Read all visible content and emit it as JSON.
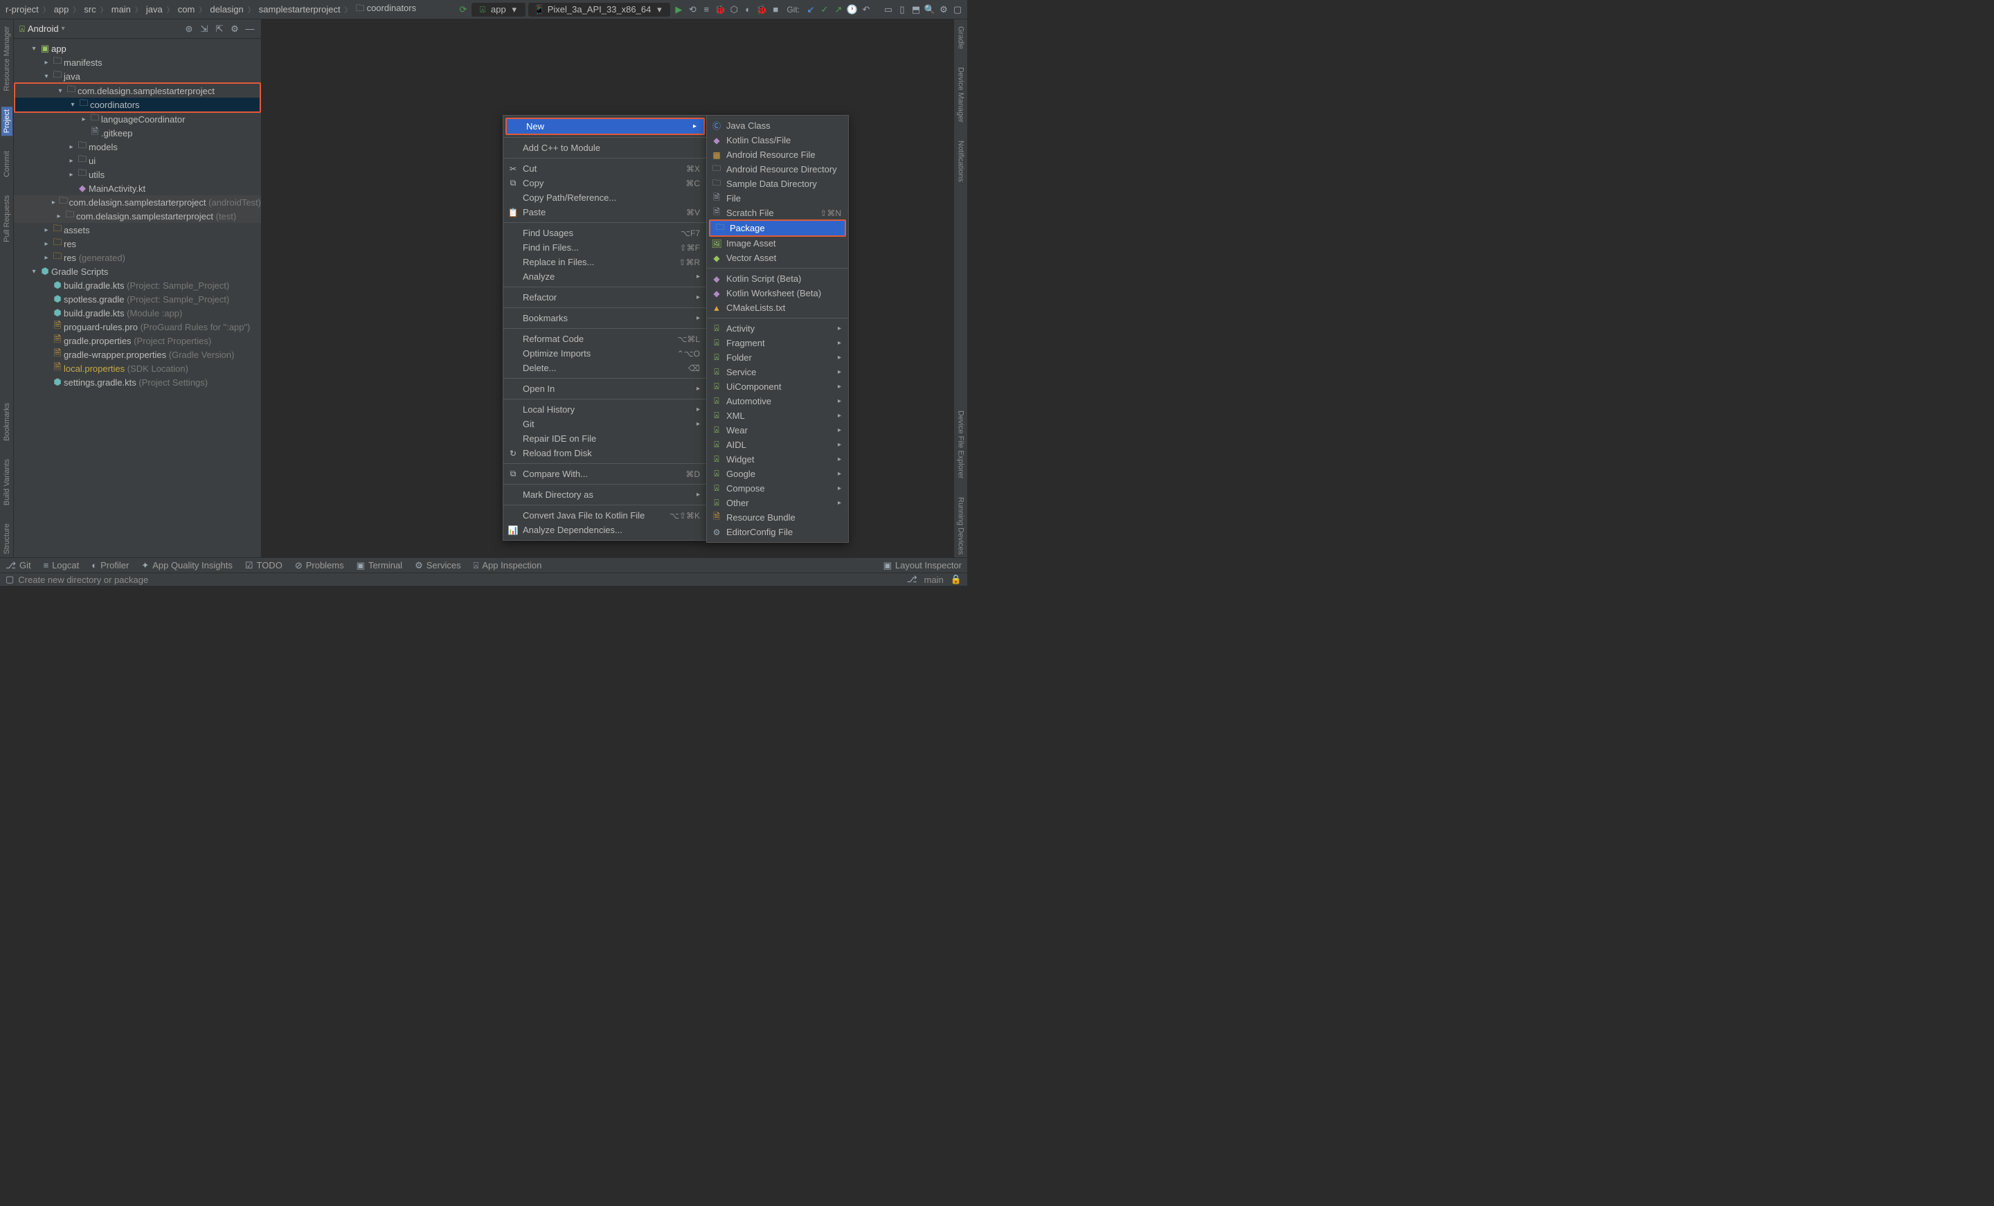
{
  "breadcrumbs": [
    "r-project",
    "app",
    "src",
    "main",
    "java",
    "com",
    "delasign",
    "samplestarterproject",
    "coordinators"
  ],
  "run_config": {
    "label": "app"
  },
  "device_select": {
    "label": "Pixel_3a_API_33_x86_64"
  },
  "git_label": "Git:",
  "left_bar": {
    "project": "Project",
    "commit": "Commit",
    "pull_requests": "Pull Requests",
    "resource_manager": "Resource Manager",
    "bookmarks": "Bookmarks",
    "build_variants": "Build Variants",
    "structure": "Structure"
  },
  "right_bar": {
    "gradle": "Gradle",
    "device_manager": "Device Manager",
    "notifications": "Notifications",
    "device_file_explorer": "Device File Explorer",
    "running_devices": "Running Devices"
  },
  "project_panel": {
    "title": "Android",
    "tree": {
      "app": "app",
      "manifests": "manifests",
      "java": "java",
      "pkg_main": "com.delasign.samplestarterproject",
      "coordinators": "coordinators",
      "languageCoordinator": "languageCoordinator",
      "gitkeep": ".gitkeep",
      "models": "models",
      "ui": "ui",
      "utils": "utils",
      "main_activity": "MainActivity.kt",
      "pkg_androidTest": "com.delasign.samplestarterproject",
      "pkg_androidTest_suffix": "(androidTest)",
      "pkg_test": "com.delasign.samplestarterproject",
      "pkg_test_suffix": "(test)",
      "assets": "assets",
      "res": "res",
      "res_gen": "res",
      "res_gen_suffix": "(generated)",
      "gradle_scripts": "Gradle Scripts",
      "bg_project": "build.gradle.kts",
      "bg_project_suffix": "(Project: Sample_Project)",
      "spotless": "spotless.gradle",
      "spotless_suffix": "(Project: Sample_Project)",
      "bg_module": "build.gradle.kts",
      "bg_module_suffix": "(Module :app)",
      "proguard": "proguard-rules.pro",
      "proguard_suffix": "(ProGuard Rules for \":app\")",
      "gradle_props": "gradle.properties",
      "gradle_props_suffix": "(Project Properties)",
      "wrapper_props": "gradle-wrapper.properties",
      "wrapper_props_suffix": "(Gradle Version)",
      "local_props": "local.properties",
      "local_props_suffix": "(SDK Location)",
      "settings": "settings.gradle.kts",
      "settings_suffix": "(Project Settings)"
    }
  },
  "context_main": [
    {
      "label": "New",
      "hl": true,
      "arrow": true
    },
    null,
    {
      "label": "Add C++ to Module"
    },
    null,
    {
      "icon": "✂",
      "label": "Cut",
      "short": "⌘X"
    },
    {
      "icon": "⧉",
      "label": "Copy",
      "short": "⌘C"
    },
    {
      "label": "Copy Path/Reference..."
    },
    {
      "icon": "📋",
      "label": "Paste",
      "short": "⌘V"
    },
    null,
    {
      "label": "Find Usages",
      "short": "⌥F7"
    },
    {
      "label": "Find in Files...",
      "short": "⇧⌘F"
    },
    {
      "label": "Replace in Files...",
      "short": "⇧⌘R"
    },
    {
      "label": "Analyze",
      "arrow": true
    },
    null,
    {
      "label": "Refactor",
      "arrow": true
    },
    null,
    {
      "label": "Bookmarks",
      "arrow": true
    },
    null,
    {
      "label": "Reformat Code",
      "short": "⌥⌘L"
    },
    {
      "label": "Optimize Imports",
      "short": "⌃⌥O"
    },
    {
      "label": "Delete...",
      "short": "⌫"
    },
    null,
    {
      "label": "Open In",
      "arrow": true
    },
    null,
    {
      "label": "Local History",
      "arrow": true
    },
    {
      "label": "Git",
      "arrow": true
    },
    {
      "label": "Repair IDE on File"
    },
    {
      "icon": "↻",
      "label": "Reload from Disk"
    },
    null,
    {
      "icon": "⧉",
      "label": "Compare With...",
      "short": "⌘D"
    },
    null,
    {
      "label": "Mark Directory as",
      "arrow": true
    },
    null,
    {
      "label": "Convert Java File to Kotlin File",
      "short": "⌥⇧⌘K"
    },
    {
      "icon": "📊",
      "label": "Analyze Dependencies..."
    }
  ],
  "context_new": [
    {
      "iconclass": "g-blue",
      "icon": "Ⓒ",
      "label": "Java Class"
    },
    {
      "iconclass": "g-purple",
      "icon": "◆",
      "label": "Kotlin Class/File"
    },
    {
      "iconclass": "g-orange",
      "icon": "▦",
      "label": "Android Resource File"
    },
    {
      "iconclass": "g-gray",
      "icon": "🗀",
      "label": "Android Resource Directory"
    },
    {
      "iconclass": "g-gray",
      "icon": "🗀",
      "label": "Sample Data Directory"
    },
    {
      "iconclass": "g-gray",
      "icon": "🗎",
      "label": "File"
    },
    {
      "iconclass": "g-gray",
      "icon": "🗎",
      "label": "Scratch File",
      "short": "⇧⌘N"
    },
    {
      "iconclass": "g-gray",
      "icon": "🗀",
      "label": "Package",
      "hl": true,
      "box": true
    },
    {
      "iconclass": "g-green",
      "icon": "🖼",
      "label": "Image Asset"
    },
    {
      "iconclass": "g-green",
      "icon": "◆",
      "label": "Vector Asset"
    },
    null,
    {
      "iconclass": "g-purple",
      "icon": "◆",
      "label": "Kotlin Script (Beta)"
    },
    {
      "iconclass": "g-purple",
      "icon": "◆",
      "label": "Kotlin Worksheet (Beta)"
    },
    {
      "iconclass": "g-orange",
      "icon": "▲",
      "label": "CMakeLists.txt"
    },
    null,
    {
      "iconclass": "g-green",
      "icon": "⍓",
      "label": "Activity",
      "arrow": true
    },
    {
      "iconclass": "g-green",
      "icon": "⍓",
      "label": "Fragment",
      "arrow": true
    },
    {
      "iconclass": "g-green",
      "icon": "⍓",
      "label": "Folder",
      "arrow": true
    },
    {
      "iconclass": "g-green",
      "icon": "⍓",
      "label": "Service",
      "arrow": true
    },
    {
      "iconclass": "g-green",
      "icon": "⍓",
      "label": "UiComponent",
      "arrow": true
    },
    {
      "iconclass": "g-green",
      "icon": "⍓",
      "label": "Automotive",
      "arrow": true
    },
    {
      "iconclass": "g-green",
      "icon": "⍓",
      "label": "XML",
      "arrow": true
    },
    {
      "iconclass": "g-green",
      "icon": "⍓",
      "label": "Wear",
      "arrow": true
    },
    {
      "iconclass": "g-green",
      "icon": "⍓",
      "label": "AIDL",
      "arrow": true
    },
    {
      "iconclass": "g-green",
      "icon": "⍓",
      "label": "Widget",
      "arrow": true
    },
    {
      "iconclass": "g-green",
      "icon": "⍓",
      "label": "Google",
      "arrow": true
    },
    {
      "iconclass": "g-green",
      "icon": "⍓",
      "label": "Compose",
      "arrow": true
    },
    {
      "iconclass": "g-green",
      "icon": "⍓",
      "label": "Other",
      "arrow": true
    },
    {
      "iconclass": "g-orange",
      "icon": "🗎",
      "label": "Resource Bundle"
    },
    {
      "iconclass": "g-gray",
      "icon": "⚙",
      "label": "EditorConfig File"
    }
  ],
  "tool_strip": {
    "git": "Git",
    "logcat": "Logcat",
    "profiler": "Profiler",
    "aqi": "App Quality Insights",
    "todo": "TODO",
    "problems": "Problems",
    "terminal": "Terminal",
    "services": "Services",
    "app_inspection": "App Inspection",
    "layout_inspector": "Layout Inspector"
  },
  "status_bar": {
    "msg": "Create new directory or package",
    "branch": "main"
  }
}
